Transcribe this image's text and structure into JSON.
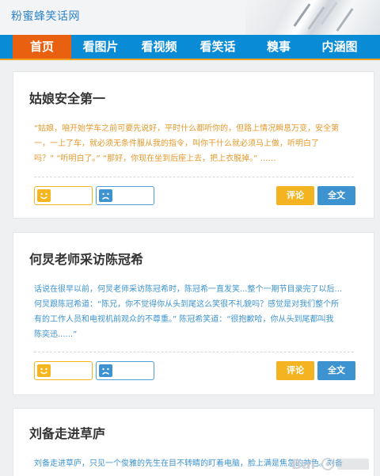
{
  "site": {
    "name": "粉蜜蜂笑话网"
  },
  "nav": {
    "items": [
      {
        "label": "首页",
        "active": true
      },
      {
        "label": "看图片",
        "active": false
      },
      {
        "label": "看视频",
        "active": false
      },
      {
        "label": "看笑话",
        "active": false
      },
      {
        "label": "糗事",
        "active": false
      },
      {
        "label": "内涵图",
        "active": false
      }
    ]
  },
  "articles": [
    {
      "title": "姑娘安全第一",
      "excerpt_lines": [
        "“姑娘，咱开始学车之前可要先说好，平时什么都听你的，但路上情况瞬息万变，安全第",
        "一，一上了车，就必须无条件服从我的指令，叫你干什么就必须马上做，听明白了",
        "吗？” “听明白了。” “那好，你现在坐到后座上去，把上衣脱掉。” ……"
      ],
      "excerpt_color": "orange",
      "comment_label": "评论",
      "full_label": "全文"
    },
    {
      "title": "何炅老师采访陈冠希",
      "excerpt_lines": [
        "话说在很早以前，何炅老师采访陈冠希时，陈冠希一直发笑...整个一期节目录完了以后...",
        "何炅跟陈冠希道：“陈兄，你不觉得你从头到尾这么笑很不礼貌吗？感觉是对我们整个所",
        "有的工作人员和电视机前观众的不尊重。” 陈冠希笑道：“很抱歉哈，你从头到尾都叫我",
        "陈奕迅......”"
      ],
      "excerpt_color": "blue",
      "comment_label": "评论",
      "full_label": "全文"
    },
    {
      "title": "刘备走进草庐",
      "excerpt_lines": [
        "刘备走进草庐，只见一个俊雅的先生在目不转睛的盯着电脑，脸上满是焦急的神色。刘备"
      ],
      "excerpt_color": "blue"
    }
  ],
  "colors": {
    "nav_bg": "#0a8bd6",
    "nav_active": "#e96010",
    "accent_orange": "#f4b421",
    "accent_blue": "#3d93cf",
    "site_name": "#2e84c8"
  },
  "icons": {
    "vote_up": "smile-face-icon",
    "vote_down": "sad-face-icon",
    "watermark": "baidu-jingyan-watermark"
  }
}
